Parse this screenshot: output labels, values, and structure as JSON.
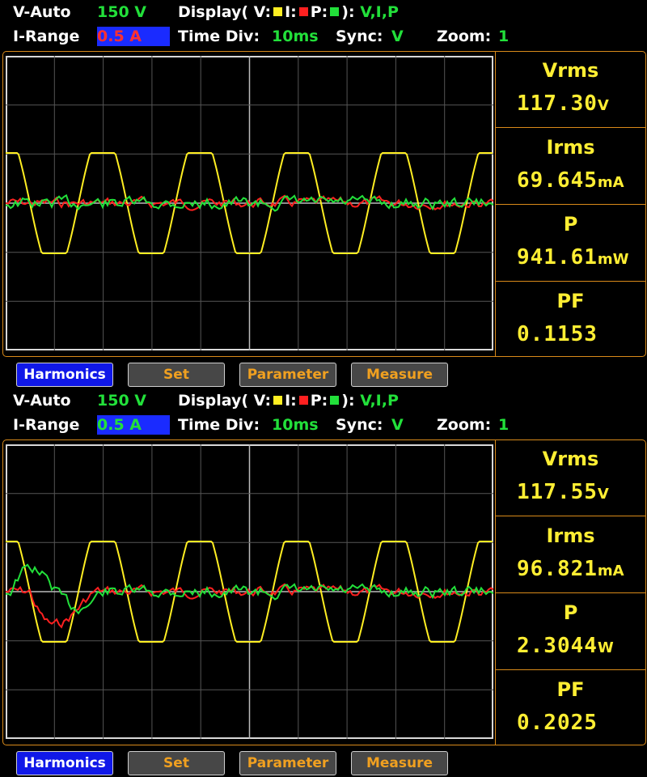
{
  "colors": {
    "voltage": "#ffee22",
    "current": "#ff2020",
    "power": "#22e03a",
    "accent": "#d98a1a"
  },
  "panels": [
    {
      "v_auto_label": "V-Auto",
      "v_range_value": "150 V",
      "display_label": "Display( V:",
      "display_i": "I:",
      "display_p": "P:",
      "display_close": "):",
      "display_channels": "V,I,P",
      "i_range_label": "I-Range",
      "i_range_value": "0.5 A",
      "time_div_label": "Time Div:",
      "time_div_value": "10ms",
      "sync_label": "Sync:",
      "sync_value": "V",
      "zoom_label": "Zoom:",
      "zoom_value": "1",
      "readings": [
        {
          "label": "Vrms",
          "value": "117.30",
          "unit": "V"
        },
        {
          "label": "Irms",
          "value": "69.645",
          "unit": "mA"
        },
        {
          "label": "P",
          "value": "941.61",
          "unit": "mW"
        },
        {
          "label": "PF",
          "value": "0.1153",
          "unit": ""
        }
      ],
      "buttons": [
        "Harmonics",
        "Set",
        "Parameter",
        "Measure"
      ]
    },
    {
      "v_auto_label": "V-Auto",
      "v_range_value": "150 V",
      "display_label": "Display( V:",
      "display_i": "I:",
      "display_p": "P:",
      "display_close": "):",
      "display_channels": "V,I,P",
      "i_range_label": "I-Range",
      "i_range_value": "0.5 A",
      "time_div_label": "Time Div:",
      "time_div_value": "10ms",
      "sync_label": "Sync:",
      "sync_value": "V",
      "zoom_label": "Zoom:",
      "zoom_value": "1",
      "readings": [
        {
          "label": "Vrms",
          "value": "117.55",
          "unit": "V"
        },
        {
          "label": "Irms",
          "value": "96.821",
          "unit": "mA"
        },
        {
          "label": "P",
          "value": "2.3044",
          "unit": "W"
        },
        {
          "label": "PF",
          "value": "0.2025",
          "unit": ""
        }
      ],
      "buttons": [
        "Harmonics",
        "Set",
        "Parameter",
        "Measure"
      ]
    }
  ]
}
